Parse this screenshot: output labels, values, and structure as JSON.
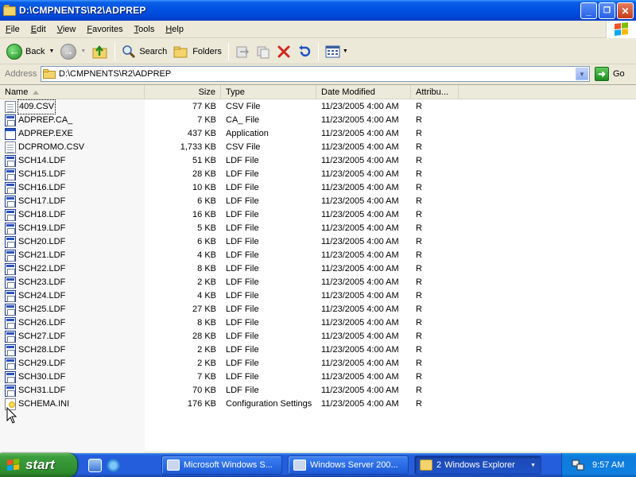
{
  "window": {
    "title": "D:\\CMPNENTS\\R2\\ADPREP",
    "controls": {
      "minimize": "_",
      "maximize": "❐",
      "close": "✕"
    }
  },
  "menu": {
    "items": [
      {
        "label": "File",
        "u": "F",
        "rest": "ile"
      },
      {
        "label": "Edit",
        "u": "E",
        "rest": "dit"
      },
      {
        "label": "View",
        "u": "V",
        "rest": "iew"
      },
      {
        "label": "Favorites",
        "u": "F",
        "rest": "avorites",
        "pre": ""
      },
      {
        "label": "Tools",
        "u": "T",
        "rest": "ools"
      },
      {
        "label": "Help",
        "u": "H",
        "rest": "elp"
      }
    ]
  },
  "toolbar": {
    "back_label": "Back",
    "search_label": "Search",
    "folders_label": "Folders"
  },
  "address": {
    "label": "Address",
    "value": "D:\\CMPNENTS\\R2\\ADPREP",
    "go_label": "Go"
  },
  "columns": {
    "name": "Name",
    "size": "Size",
    "type": "Type",
    "date": "Date Modified",
    "attr": "Attribu..."
  },
  "files": [
    {
      "name": "409.CSV",
      "size": "77 KB",
      "type": "CSV File",
      "date": "11/23/2005 4:00 AM",
      "attr": "R",
      "icon": "doc"
    },
    {
      "name": "ADPREP.CA_",
      "size": "7 KB",
      "type": "CA_ File",
      "date": "11/23/2005 4:00 AM",
      "attr": "R",
      "icon": "sys"
    },
    {
      "name": "ADPREP.EXE",
      "size": "437 KB",
      "type": "Application",
      "date": "11/23/2005 4:00 AM",
      "attr": "R",
      "icon": "app"
    },
    {
      "name": "DCPROMO.CSV",
      "size": "1,733 KB",
      "type": "CSV File",
      "date": "11/23/2005 4:00 AM",
      "attr": "R",
      "icon": "doc"
    },
    {
      "name": "SCH14.LDF",
      "size": "51 KB",
      "type": "LDF File",
      "date": "11/23/2005 4:00 AM",
      "attr": "R",
      "icon": "sys"
    },
    {
      "name": "SCH15.LDF",
      "size": "28 KB",
      "type": "LDF File",
      "date": "11/23/2005 4:00 AM",
      "attr": "R",
      "icon": "sys"
    },
    {
      "name": "SCH16.LDF",
      "size": "10 KB",
      "type": "LDF File",
      "date": "11/23/2005 4:00 AM",
      "attr": "R",
      "icon": "sys"
    },
    {
      "name": "SCH17.LDF",
      "size": "6 KB",
      "type": "LDF File",
      "date": "11/23/2005 4:00 AM",
      "attr": "R",
      "icon": "sys"
    },
    {
      "name": "SCH18.LDF",
      "size": "16 KB",
      "type": "LDF File",
      "date": "11/23/2005 4:00 AM",
      "attr": "R",
      "icon": "sys"
    },
    {
      "name": "SCH19.LDF",
      "size": "5 KB",
      "type": "LDF File",
      "date": "11/23/2005 4:00 AM",
      "attr": "R",
      "icon": "sys"
    },
    {
      "name": "SCH20.LDF",
      "size": "6 KB",
      "type": "LDF File",
      "date": "11/23/2005 4:00 AM",
      "attr": "R",
      "icon": "sys"
    },
    {
      "name": "SCH21.LDF",
      "size": "4 KB",
      "type": "LDF File",
      "date": "11/23/2005 4:00 AM",
      "attr": "R",
      "icon": "sys"
    },
    {
      "name": "SCH22.LDF",
      "size": "8 KB",
      "type": "LDF File",
      "date": "11/23/2005 4:00 AM",
      "attr": "R",
      "icon": "sys"
    },
    {
      "name": "SCH23.LDF",
      "size": "2 KB",
      "type": "LDF File",
      "date": "11/23/2005 4:00 AM",
      "attr": "R",
      "icon": "sys"
    },
    {
      "name": "SCH24.LDF",
      "size": "4 KB",
      "type": "LDF File",
      "date": "11/23/2005 4:00 AM",
      "attr": "R",
      "icon": "sys"
    },
    {
      "name": "SCH25.LDF",
      "size": "27 KB",
      "type": "LDF File",
      "date": "11/23/2005 4:00 AM",
      "attr": "R",
      "icon": "sys"
    },
    {
      "name": "SCH26.LDF",
      "size": "8 KB",
      "type": "LDF File",
      "date": "11/23/2005 4:00 AM",
      "attr": "R",
      "icon": "sys"
    },
    {
      "name": "SCH27.LDF",
      "size": "28 KB",
      "type": "LDF File",
      "date": "11/23/2005 4:00 AM",
      "attr": "R",
      "icon": "sys"
    },
    {
      "name": "SCH28.LDF",
      "size": "2 KB",
      "type": "LDF File",
      "date": "11/23/2005 4:00 AM",
      "attr": "R",
      "icon": "sys"
    },
    {
      "name": "SCH29.LDF",
      "size": "2 KB",
      "type": "LDF File",
      "date": "11/23/2005 4:00 AM",
      "attr": "R",
      "icon": "sys"
    },
    {
      "name": "SCH30.LDF",
      "size": "7 KB",
      "type": "LDF File",
      "date": "11/23/2005 4:00 AM",
      "attr": "R",
      "icon": "sys"
    },
    {
      "name": "SCH31.LDF",
      "size": "70 KB",
      "type": "LDF File",
      "date": "11/23/2005 4:00 AM",
      "attr": "R",
      "icon": "sys"
    },
    {
      "name": "SCHEMA.INI",
      "size": "176 KB",
      "type": "Configuration Settings",
      "date": "11/23/2005 4:00 AM",
      "attr": "R",
      "icon": "ini"
    }
  ],
  "taskbar": {
    "start_label": "start",
    "tasks": [
      {
        "label": "Microsoft Windows S...",
        "count": ""
      },
      {
        "label": "Windows Server 200...",
        "count": ""
      },
      {
        "label": "Windows Explorer",
        "count": "2"
      }
    ],
    "clock": "9:57 AM"
  },
  "colors": {
    "titlebar": "#0054E3",
    "start_green": "#3C9E3C",
    "taskbar_blue": "#245EDC",
    "tray_blue": "#0F80E0"
  }
}
